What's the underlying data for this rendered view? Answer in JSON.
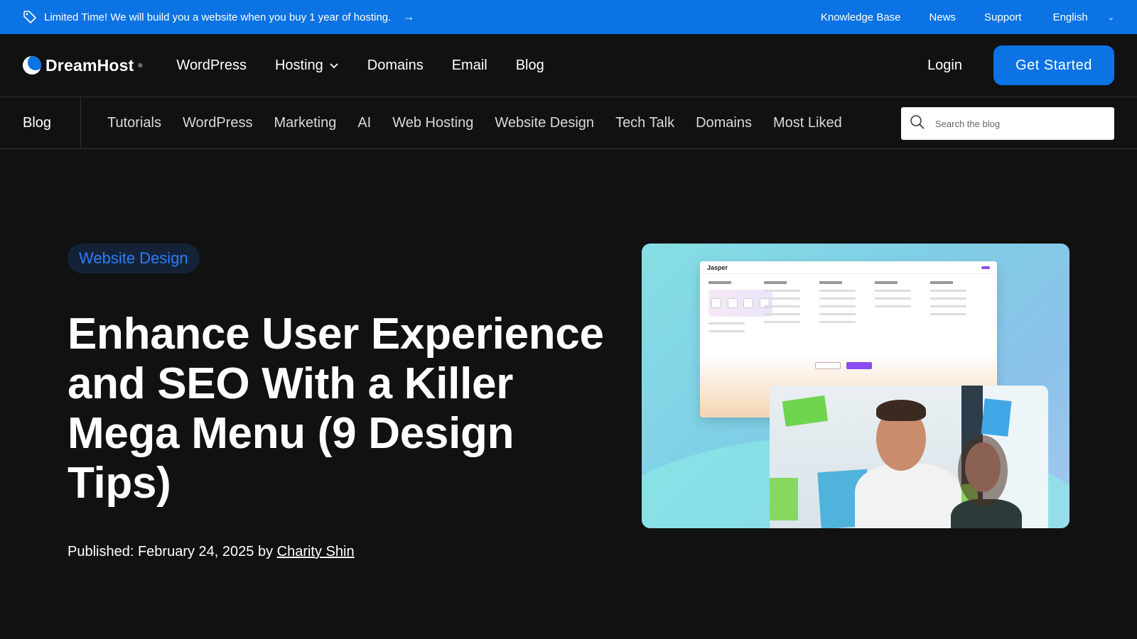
{
  "promo": {
    "text": "Limited Time! We will build you a website when you buy 1 year of hosting.",
    "arrow": "→",
    "links": [
      "Knowledge Base",
      "News",
      "Support"
    ],
    "language": "English"
  },
  "nav": {
    "brand": "DreamHost",
    "items": [
      {
        "label": "WordPress"
      },
      {
        "label": "Hosting"
      },
      {
        "label": "Domains"
      },
      {
        "label": "Email"
      },
      {
        "label": "Blog"
      }
    ],
    "login": "Login",
    "cta": "Get Started"
  },
  "blog_nav": {
    "home": "Blog",
    "categories": [
      "Tutorials",
      "WordPress",
      "Marketing",
      "AI",
      "Web Hosting",
      "Website Design",
      "Tech Talk",
      "Domains",
      "Most Liked"
    ],
    "search_placeholder": "Search the blog"
  },
  "article": {
    "category": "Website Design",
    "title": "Enhance User Experience and SEO With a Killer Mega Menu (9 Design Tips)",
    "published_label": "Published: February 24, 2025 by",
    "author": "Charity Shin"
  },
  "hero_image": {
    "mock_brand": "Jasper"
  },
  "colors": {
    "accent": "#0b73e3",
    "background": "#111112",
    "tag_text": "#2d7df6",
    "tag_bg": "#142238"
  }
}
